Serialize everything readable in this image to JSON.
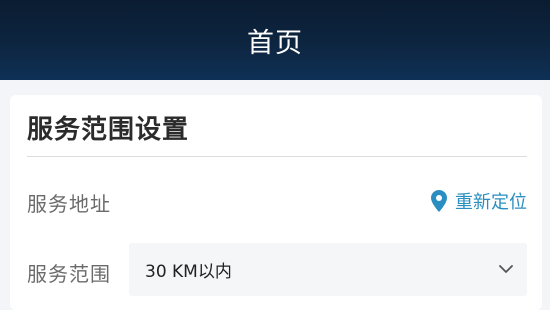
{
  "header": {
    "title": "首页"
  },
  "service_settings": {
    "title": "服务范围设置",
    "address_label": "服务地址",
    "relocate_label": "重新定位",
    "range_label": "服务范围",
    "range_value": "30 KM以内"
  },
  "icons": {
    "relocate": "map-pin-icon",
    "dropdown": "chevron-down-icon"
  },
  "colors": {
    "header": "#0d2540",
    "accent": "#2a8fc0"
  }
}
